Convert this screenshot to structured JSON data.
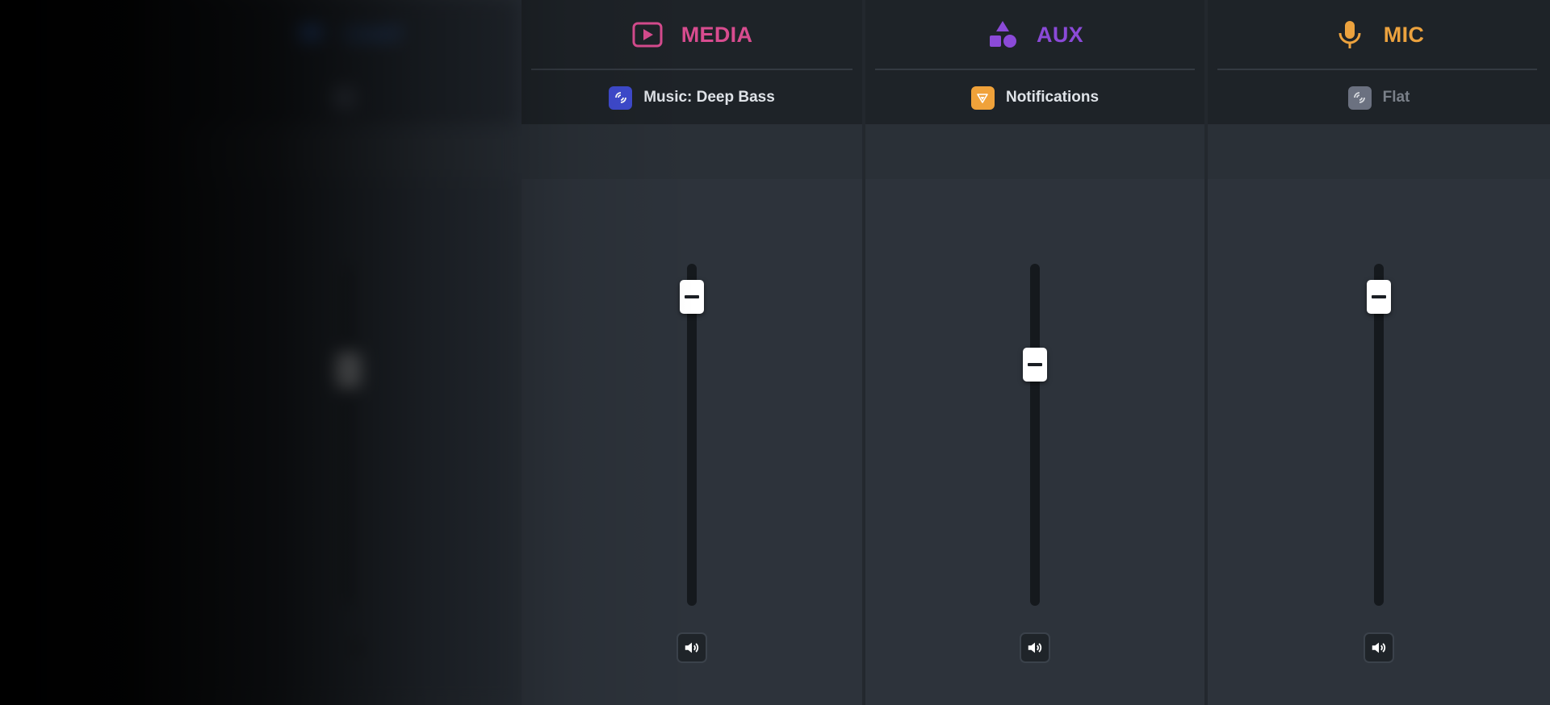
{
  "channels": [
    {
      "id": "chat",
      "title": "CHAT",
      "color": "#2f6fd6",
      "icon": "chat-icon",
      "preset": "",
      "preset_icon": "equalizer-icon",
      "preset_color": "#4a5260",
      "volume": 0.77,
      "muted": false,
      "faded": true
    },
    {
      "id": "media",
      "title": "MEDIA",
      "color": "#d84c8f",
      "icon": "play-icon",
      "preset": "Music: Deep Bass",
      "preset_icon": "equalizer-icon",
      "preset_color": "#3f4bd0",
      "volume": 0.99,
      "muted": false,
      "faded": false
    },
    {
      "id": "aux",
      "title": "AUX",
      "color": "#8b4ad8",
      "icon": "shapes-icon",
      "preset": "Notifications",
      "preset_icon": "bell-icon",
      "preset_color": "#f0a23a",
      "volume": 0.77,
      "muted": false,
      "faded": false
    },
    {
      "id": "mic",
      "title": "MIC",
      "color": "#eca23e",
      "icon": "microphone-icon",
      "preset": "Flat",
      "preset_icon": "equalizer-icon",
      "preset_color": "#6b7180",
      "preset_text_color": "#7a8089",
      "volume": 0.99,
      "muted": false,
      "faded": false
    }
  ]
}
